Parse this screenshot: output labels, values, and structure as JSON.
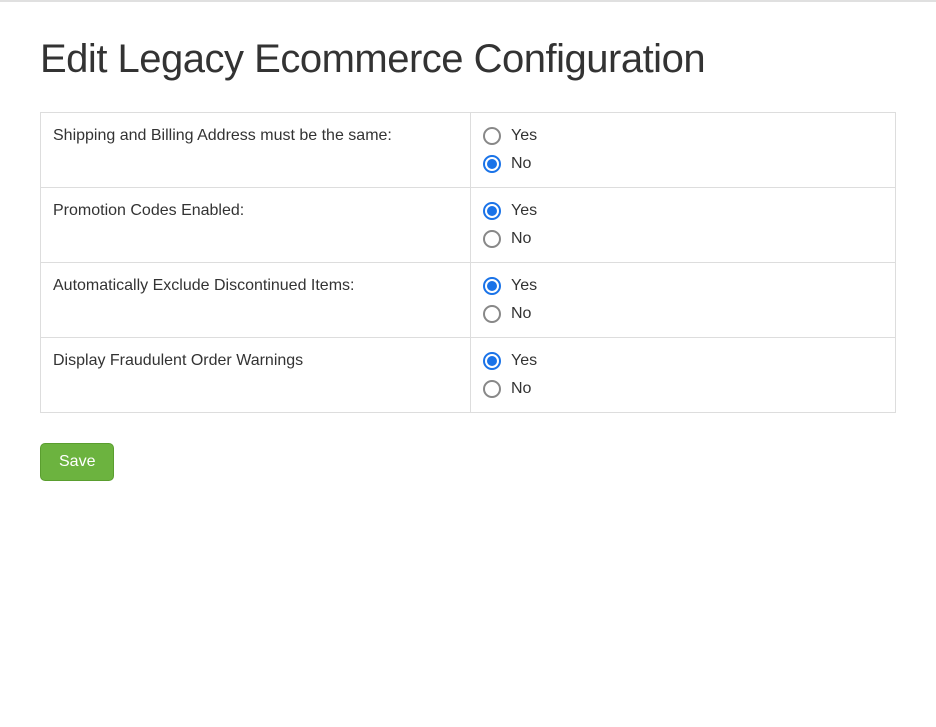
{
  "title": "Edit Legacy Ecommerce Configuration",
  "options": {
    "yes": "Yes",
    "no": "No"
  },
  "fields": [
    {
      "label": "Shipping and Billing Address must be the same:",
      "name": "shipping-billing-same",
      "value": "No"
    },
    {
      "label": "Promotion Codes Enabled:",
      "name": "promotion-codes-enabled",
      "value": "Yes"
    },
    {
      "label": "Automatically Exclude Discontinued Items:",
      "name": "exclude-discontinued-items",
      "value": "Yes"
    },
    {
      "label": "Display Fraudulent Order Warnings",
      "name": "display-fraud-warnings",
      "value": "Yes"
    }
  ],
  "actions": {
    "save": "Save"
  }
}
